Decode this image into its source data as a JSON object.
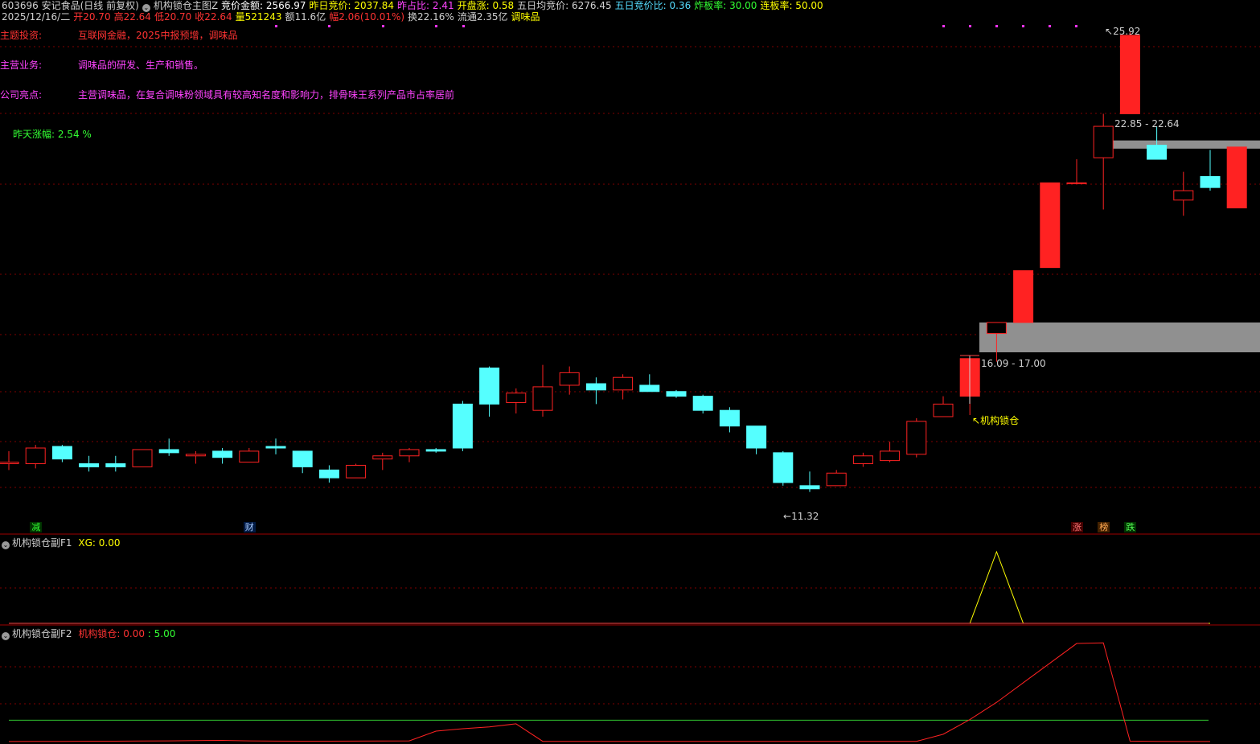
{
  "header": {
    "line1": [
      {
        "t": "603696 安记食品(日线 前复权)",
        "c": "#d0d0d0"
      },
      {
        "t": "机构锁仓主图Z",
        "c": "#d0d0d0",
        "icon": true
      },
      {
        "t": "竞价金额: 2566.97",
        "c": "#ffffff"
      },
      {
        "t": "昨日竞价: 2037.84",
        "c": "#ffff00"
      },
      {
        "t": "昨占比: 2.41",
        "c": "#ff44ff"
      },
      {
        "t": "开盘涨: 0.58",
        "c": "#ffff00"
      },
      {
        "t": "五日均竞价: 6276.45",
        "c": "#d0d0d0"
      },
      {
        "t": "五日竞价比: 0.36",
        "c": "#55ddff"
      },
      {
        "t": "炸板率: 30.00",
        "c": "#33ff33"
      },
      {
        "t": "连板率: 50.00",
        "c": "#ffff00"
      }
    ],
    "line2": [
      {
        "t": "2025/12/16/二",
        "c": "#d0d0d0"
      },
      {
        "t": "开20.70",
        "c": "#ff3333"
      },
      {
        "t": "高22.64",
        "c": "#ff3333"
      },
      {
        "t": "低20.70",
        "c": "#ff3333"
      },
      {
        "t": "收22.64",
        "c": "#ff3333"
      },
      {
        "t": "量521243",
        "c": "#ffff00"
      },
      {
        "t": "额11.6亿",
        "c": "#d0d0d0"
      },
      {
        "t": "幅2.06(10.01%)",
        "c": "#ff3333"
      },
      {
        "t": "换22.16%",
        "c": "#d0d0d0"
      },
      {
        "t": "流通2.35亿",
        "c": "#d0d0d0"
      },
      {
        "t": "调味品",
        "c": "#ffff00"
      }
    ]
  },
  "info": {
    "rows": [
      {
        "label": "主题投资:",
        "value": "互联网金融，2025中报预增，调味品",
        "lc": "#ff3333",
        "vc": "#ff3333"
      },
      {
        "label": "主营业务:",
        "value": "调味品的研发、生产和销售。",
        "lc": "#ff44ff",
        "vc": "#ff44ff"
      },
      {
        "label": "公司亮点:",
        "value": "主营调味品，在复合调味粉领域具有较高知名度和影响力，排骨味王系列产品市占率居前",
        "lc": "#ff44ff",
        "vc": "#ff44ff"
      }
    ],
    "yesterday": "昨天涨幅: 2.54 %"
  },
  "annotations": {
    "high": "25.92",
    "low": "11.32",
    "zone_upper": "22.85 - 22.64",
    "zone_lower": "16.09 - 17.00",
    "signal": "机构锁仓"
  },
  "badges": [
    {
      "t": "减",
      "c": "#33ff33",
      "bg": "#003300",
      "i": 1
    },
    {
      "t": "财",
      "c": "#aaccff",
      "bg": "#001a44",
      "i": 9
    },
    {
      "t": "涨",
      "c": "#ff7777",
      "bg": "#440000",
      "i": 40
    },
    {
      "t": "榜",
      "c": "#ffaa55",
      "bg": "#442200",
      "i": 41
    },
    {
      "t": "跌",
      "c": "#55ff55",
      "bg": "#003300",
      "i": 42
    }
  ],
  "sub1": {
    "title": "机构锁仓副F1",
    "xg": "XG: 0.00"
  },
  "sub2": {
    "title": "机构锁仓副F2",
    "name": "机构锁仓:",
    "v1": "0.00",
    "v2": ": 5.00"
  },
  "colors": {
    "up": "#ff2222",
    "down": "#55ffff",
    "grid": "#800000",
    "zone": "#909090"
  },
  "chart_data": {
    "type": "candlestick",
    "ylim": [
      11.0,
      26.3
    ],
    "candles": [
      {
        "o": 12.55,
        "h": 12.95,
        "l": 12.35,
        "c": 12.6
      },
      {
        "o": 12.55,
        "h": 13.15,
        "l": 12.4,
        "c": 13.05
      },
      {
        "o": 13.1,
        "h": 13.15,
        "l": 12.6,
        "c": 12.7
      },
      {
        "o": 12.55,
        "h": 12.8,
        "l": 12.3,
        "c": 12.45
      },
      {
        "o": 12.55,
        "h": 12.8,
        "l": 12.3,
        "c": 12.45
      },
      {
        "o": 12.45,
        "h": 13.0,
        "l": 12.45,
        "c": 13.0
      },
      {
        "o": 13.0,
        "h": 13.35,
        "l": 12.8,
        "c": 12.9
      },
      {
        "o": 12.8,
        "h": 12.95,
        "l": 12.55,
        "c": 12.85
      },
      {
        "o": 12.95,
        "h": 13.05,
        "l": 12.55,
        "c": 12.75
      },
      {
        "o": 12.6,
        "h": 13.05,
        "l": 12.6,
        "c": 12.95
      },
      {
        "o": 13.1,
        "h": 13.35,
        "l": 12.85,
        "c": 13.05
      },
      {
        "o": 12.95,
        "h": 12.95,
        "l": 12.25,
        "c": 12.45
      },
      {
        "o": 12.35,
        "h": 12.5,
        "l": 11.95,
        "c": 12.1
      },
      {
        "o": 12.1,
        "h": 12.55,
        "l": 12.1,
        "c": 12.5
      },
      {
        "o": 12.7,
        "h": 12.9,
        "l": 12.35,
        "c": 12.8
      },
      {
        "o": 12.8,
        "h": 13.05,
        "l": 12.6,
        "c": 13.0
      },
      {
        "o": 13.0,
        "h": 13.05,
        "l": 12.9,
        "c": 12.95
      },
      {
        "o": 14.45,
        "h": 14.55,
        "l": 12.95,
        "c": 13.05
      },
      {
        "o": 15.6,
        "h": 15.65,
        "l": 14.05,
        "c": 14.45
      },
      {
        "o": 14.5,
        "h": 14.95,
        "l": 14.15,
        "c": 14.8
      },
      {
        "o": 14.25,
        "h": 15.7,
        "l": 14.05,
        "c": 15.0
      },
      {
        "o": 15.05,
        "h": 15.65,
        "l": 14.75,
        "c": 15.45
      },
      {
        "o": 15.1,
        "h": 15.3,
        "l": 14.45,
        "c": 14.9
      },
      {
        "o": 14.9,
        "h": 15.4,
        "l": 14.6,
        "c": 15.3
      },
      {
        "o": 15.05,
        "h": 15.4,
        "l": 14.85,
        "c": 14.85
      },
      {
        "o": 14.85,
        "h": 14.9,
        "l": 14.65,
        "c": 14.7
      },
      {
        "o": 14.7,
        "h": 14.75,
        "l": 14.15,
        "c": 14.25
      },
      {
        "o": 14.25,
        "h": 14.35,
        "l": 13.55,
        "c": 13.75
      },
      {
        "o": 13.75,
        "h": 13.75,
        "l": 12.85,
        "c": 13.05
      },
      {
        "o": 12.9,
        "h": 12.95,
        "l": 11.85,
        "c": 11.95
      },
      {
        "o": 11.85,
        "h": 12.3,
        "l": 11.65,
        "c": 11.75
      },
      {
        "o": 11.85,
        "h": 12.35,
        "l": 11.85,
        "c": 12.25
      },
      {
        "o": 12.55,
        "h": 12.9,
        "l": 12.45,
        "c": 12.8
      },
      {
        "o": 12.65,
        "h": 13.25,
        "l": 12.6,
        "c": 12.95
      },
      {
        "o": 12.85,
        "h": 14.0,
        "l": 12.75,
        "c": 13.9
      },
      {
        "o": 14.05,
        "h": 14.7,
        "l": 14.05,
        "c": 14.45
      },
      {
        "o": 14.7,
        "h": 15.9,
        "l": 14.1,
        "c": 15.9
      },
      {
        "o": 16.7,
        "h": 17.05,
        "l": 15.8,
        "c": 17.05
      },
      {
        "o": 17.05,
        "h": 18.7,
        "l": 17.05,
        "c": 18.7
      },
      {
        "o": 18.8,
        "h": 21.5,
        "l": 18.8,
        "c": 21.5
      },
      {
        "o": 21.5,
        "h": 22.25,
        "l": 21.5,
        "c": 21.5
      },
      {
        "o": 22.3,
        "h": 23.7,
        "l": 20.65,
        "c": 23.3
      },
      {
        "o": 23.7,
        "h": 26.3,
        "l": 23.7,
        "c": 26.2
      },
      {
        "o": 22.7,
        "h": 23.3,
        "l": 22.25,
        "c": 22.25
      },
      {
        "o": 20.95,
        "h": 21.85,
        "l": 20.45,
        "c": 21.25
      },
      {
        "o": 21.7,
        "h": 22.55,
        "l": 21.25,
        "c": 21.35
      },
      {
        "o": 20.7,
        "h": 22.64,
        "l": 20.7,
        "c": 22.64
      }
    ],
    "f1_values": [
      0,
      0,
      0,
      0,
      0,
      0,
      0,
      0,
      0,
      0,
      0,
      0,
      0,
      0,
      0,
      0,
      0,
      0,
      0,
      0,
      0,
      0,
      0,
      0,
      0,
      0,
      0,
      0,
      0,
      0,
      0,
      0,
      0,
      0,
      0,
      0,
      0,
      100,
      0,
      0,
      0,
      0,
      0,
      0,
      0,
      0
    ],
    "f2_values": [
      0.1,
      0.15,
      0.2,
      0.3,
      0.35,
      0.5,
      0.6,
      0.8,
      1.0,
      0.6,
      0.4,
      0.3,
      0.3,
      0.4,
      0.5,
      0.6,
      8.5,
      10.5,
      12.0,
      14.5,
      0.2,
      0.2,
      0.2,
      0.2,
      0.2,
      0.2,
      0.2,
      0.2,
      0.2,
      0.2,
      0.2,
      0.2,
      0.2,
      0.2,
      0.2,
      6.0,
      18.0,
      32.0,
      48.0,
      64.0,
      80.0,
      80.5,
      0.4,
      0.2,
      0.1,
      0.1
    ],
    "f2_ref": 17.5
  }
}
